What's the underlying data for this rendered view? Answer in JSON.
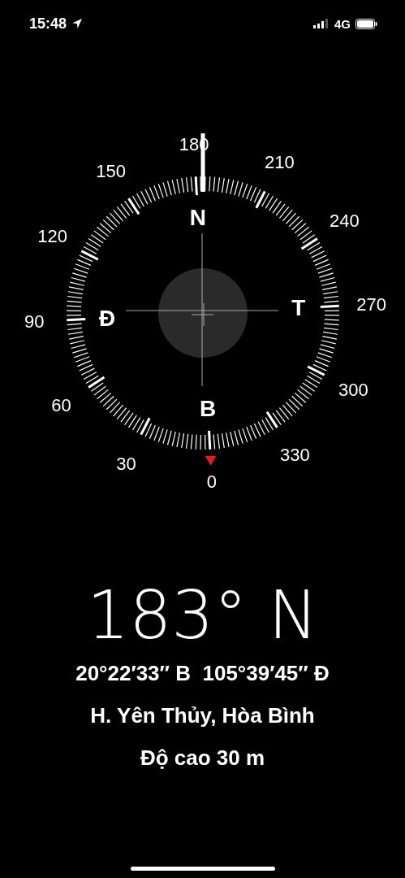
{
  "status_bar": {
    "time": "15:48",
    "network": "4G"
  },
  "compass": {
    "degree_labels": [
      "0",
      "30",
      "60",
      "90",
      "120",
      "150",
      "180",
      "210",
      "240",
      "270",
      "300",
      "330"
    ],
    "cardinal_labels": [
      "B",
      "Đ",
      "N",
      "T"
    ]
  },
  "heading": "183° N",
  "coordinates": "20°22′33″ B  105°39′45″ Đ",
  "location": "H. Yên Thủy, Hòa Bình",
  "altitude": "Độ cao 30 m"
}
